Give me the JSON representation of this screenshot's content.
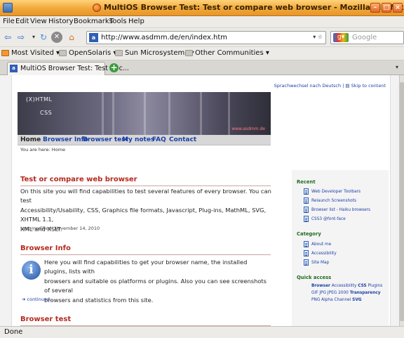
{
  "window": {
    "title": "MultiOS Browser Test: Test or compare web browser - Mozilla Firefox"
  },
  "menu": [
    "File",
    "Edit",
    "View",
    "History",
    "Bookmarks",
    "Tools",
    "Help"
  ],
  "toolbar": {
    "url": "http://www.asdmm.de/en/index.htm",
    "search_placeholder": "Google",
    "search_engine_icon": "google-icon"
  },
  "bookmarks": [
    "Most Visited",
    "OpenSolaris",
    "Sun Microsystems",
    "Other Communities"
  ],
  "tab": {
    "label": "MultiOS Browser Test: Test or c..."
  },
  "page": {
    "lang_links": "Sprachwechsel nach Deutsch | ▤ Skip to content",
    "banner": {
      "line1": "(X)HTML",
      "line2": "CSS",
      "watermark": "www.asdmm.de"
    },
    "nav": [
      "Home",
      "Browser Info",
      "Browser test",
      "My notes",
      "FAQ",
      "Contact"
    ],
    "breadcrumb": "You are here: Home",
    "section1": {
      "title": "Test or compare web browser",
      "line1": "On this site you will find capabilities to test several features of every browser. You can test",
      "line2": "Accessibility/Usability, CSS, Graphics file formats, Javascript, Plug-ins, MathML, SVG, XHTML 1.1,",
      "line3": "XML and XSLT.",
      "modified": "Last modified: November 14, 2010"
    },
    "section2": {
      "title": "Browser Info",
      "line1": "Here you will find capabilities to get your browser name, the installed plugins, lists with",
      "line2": "browsers and suitable os platforms or plugins. Also you can see screenshots of several",
      "line3": "browsers and statistics from this site.",
      "continued": "➔ continued..."
    },
    "section3": {
      "title": "Browser test"
    }
  },
  "sidebar": {
    "recent_title": "Recent",
    "recent": [
      "Web Developer Toolbars",
      "Relaunch Screenshots",
      "Browser list - Haiku browsers",
      "CSS3 @font-face"
    ],
    "category_title": "Category",
    "category": [
      "About me",
      "Accessibility",
      "Site Map"
    ],
    "quick_title": "Quick access",
    "quick1": {
      "a": "Browser",
      "b": "Accessibility",
      "c": "CSS",
      "d": "Plugins"
    },
    "quick2": {
      "a": "GIF JPG JPEG 2000",
      "b": "Transparency"
    },
    "quick3": {
      "a": "PNG Alpha Channel",
      "b": "SVG"
    }
  },
  "status": {
    "text": "Done"
  }
}
